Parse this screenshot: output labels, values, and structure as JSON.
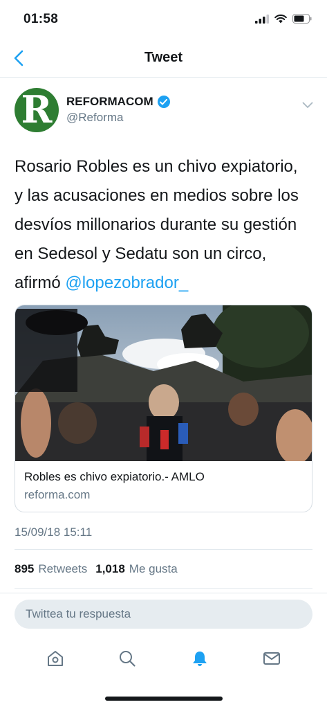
{
  "status_bar": {
    "time": "01:58"
  },
  "nav": {
    "title": "Tweet"
  },
  "tweet": {
    "author_name": "REFORMACOM",
    "author_handle": "@Reforma",
    "avatar_letter": "R",
    "text_lines": [
      "Rosario Robles es un chivo expiatorio,",
      "y las acusaciones en medios sobre los",
      "desvíos millonarios durante su gestión",
      "en Sedesol y Sedatu son un circo,"
    ],
    "text_last_prefix": "afirmó ",
    "mention": "@lopezobrador_",
    "timestamp": "15/09/18 15:11"
  },
  "card": {
    "title": "Robles es chivo expiatorio.- AMLO",
    "domain": "reforma.com"
  },
  "stats": {
    "retweets_count": "895",
    "retweets_label": "Retweets",
    "likes_count": "1,018",
    "likes_label": "Me gusta"
  },
  "reply": {
    "placeholder": "Twittea tu respuesta"
  },
  "tabs": [
    "home-icon",
    "search-icon",
    "notifications-icon",
    "messages-icon"
  ],
  "colors": {
    "accent": "#1da1f2",
    "avatar_bg": "#2e7d32",
    "muted": "#657786"
  }
}
